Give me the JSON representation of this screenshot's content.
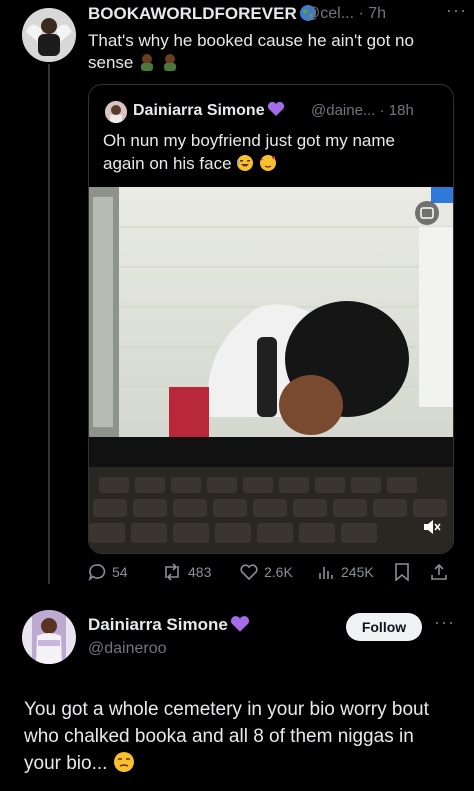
{
  "tweet": {
    "author_name": "BOOKAWORLDFOREVER",
    "handle_time": "@cel... · 7h",
    "more": "···",
    "text": "That's why he booked cause he ain't got no sense"
  },
  "quote": {
    "author_name": "Dainiarra Simone",
    "handle_time": "@daine... · 18h",
    "text": "Oh nun my boyfriend just got my name again on his face"
  },
  "stats": {
    "replies": "54",
    "retweets": "483",
    "likes": "2.6K",
    "views": "245K"
  },
  "reply": {
    "author_name": "Dainiarra Simone",
    "handle": "@daineroo",
    "follow_label": "Follow",
    "more": "···",
    "text": "You got a whole cemetery in your bio worry bout who chalked booka and all 8 of them niggas in your bio..."
  },
  "colors": {
    "background": "#000000",
    "text": "#e7e9ea",
    "muted": "#71767b",
    "verified_heart": "#a56ce8",
    "border": "#2f3336"
  }
}
